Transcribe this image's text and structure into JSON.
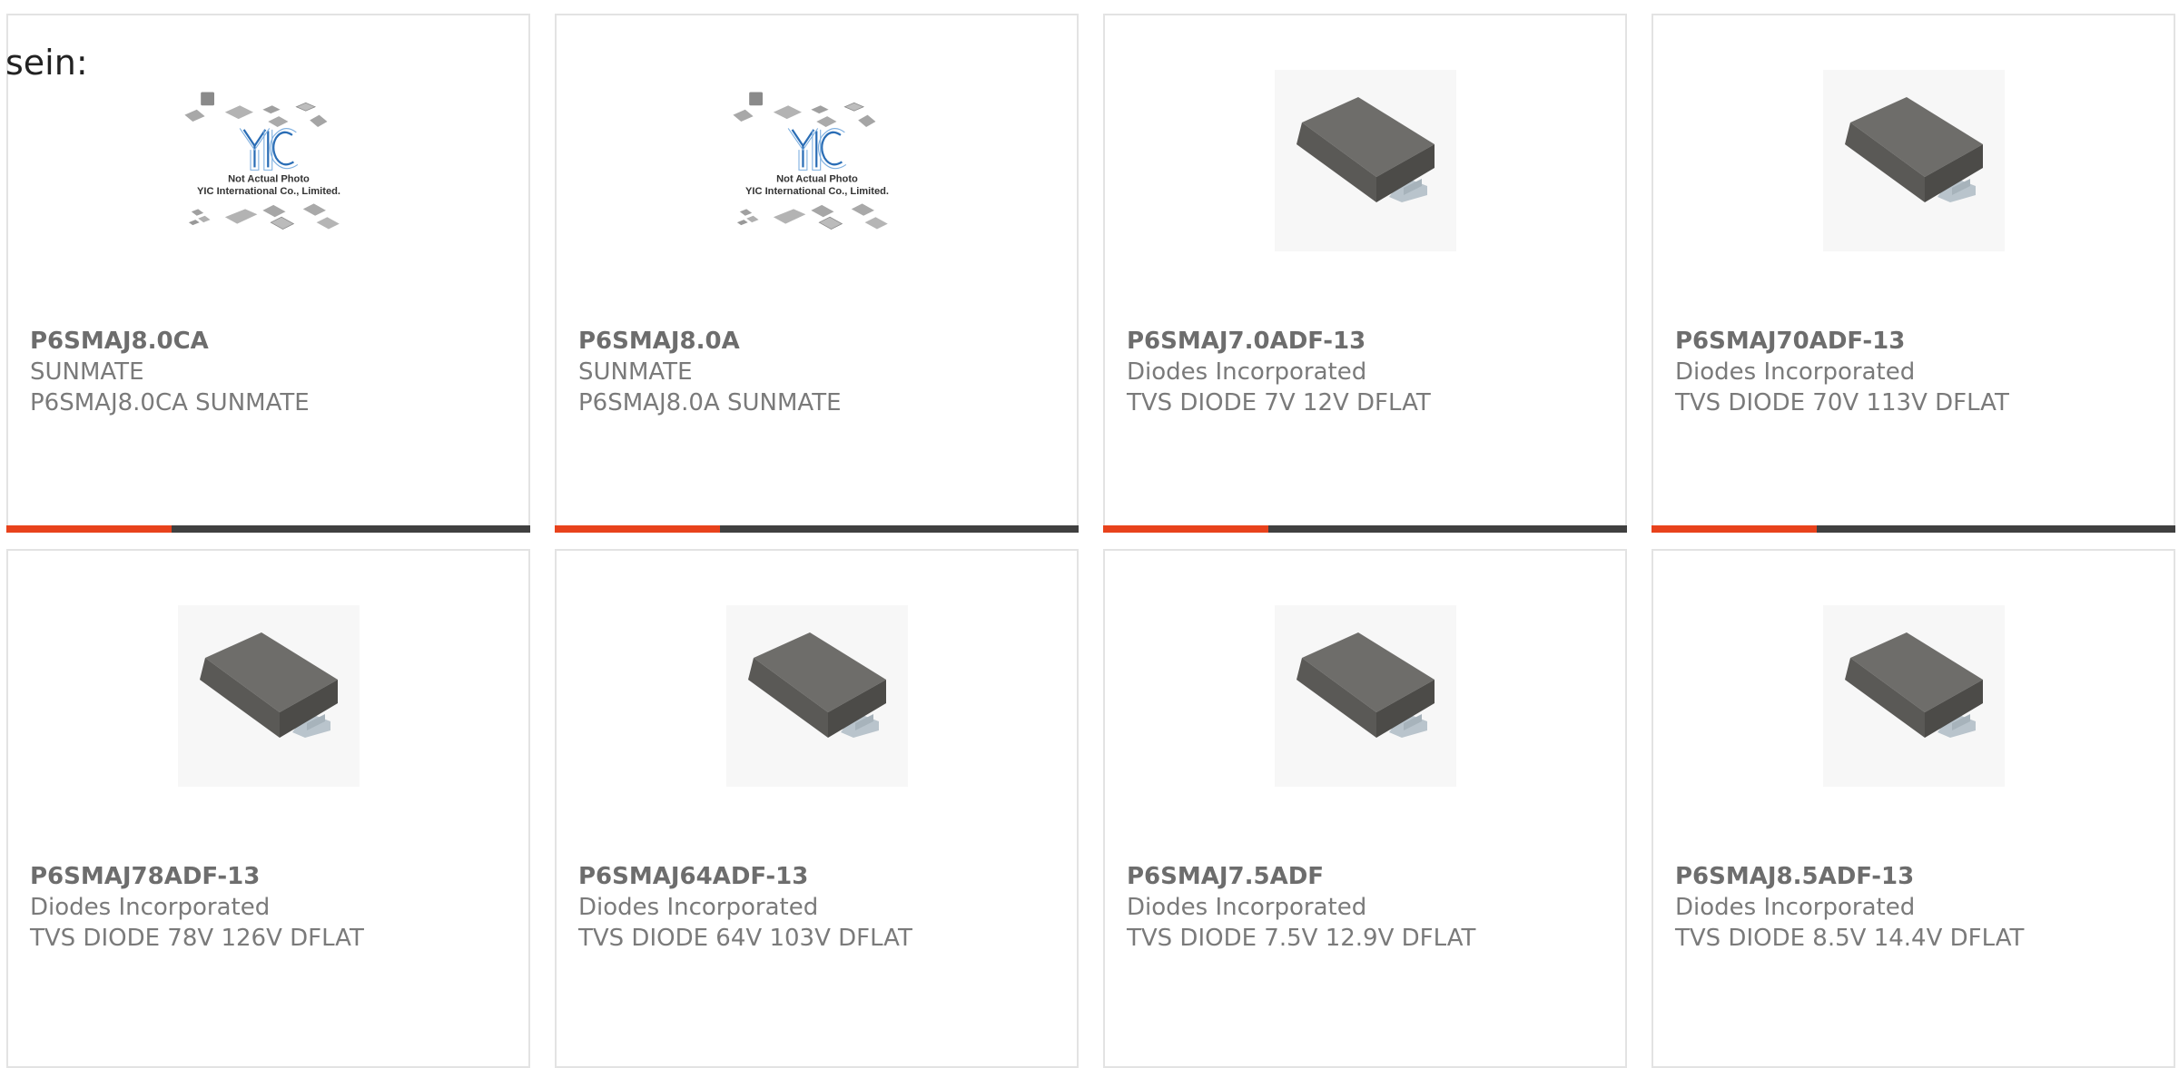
{
  "intro_text": "sein:",
  "placeholder_image": {
    "logo_text": "YIC",
    "caption_line1": "Not Actual Photo",
    "caption_line2": "YIC International Co., Limited."
  },
  "colors": {
    "accent": "#e8421c",
    "bar_dark": "#404040",
    "card_border": "#e3e3e3",
    "text": "#7a7a7a",
    "logo_blue": "#2a6db5"
  },
  "products": [
    {
      "part_number": "P6SMAJ8.0CA",
      "manufacturer": "SUNMATE",
      "description": "P6SMAJ8.0CA SUNMATE",
      "image": "yic-placeholder"
    },
    {
      "part_number": "P6SMAJ8.0A",
      "manufacturer": "SUNMATE",
      "description": "P6SMAJ8.0A SUNMATE",
      "image": "yic-placeholder"
    },
    {
      "part_number": "P6SMAJ7.0ADF-13",
      "manufacturer": "Diodes Incorporated",
      "description": "TVS DIODE 7V 12V DFLAT",
      "image": "smd-diode-package"
    },
    {
      "part_number": "P6SMAJ70ADF-13",
      "manufacturer": "Diodes Incorporated",
      "description": "TVS DIODE 70V 113V DFLAT",
      "image": "smd-diode-package"
    },
    {
      "part_number": "P6SMAJ78ADF-13",
      "manufacturer": "Diodes Incorporated",
      "description": "TVS DIODE 78V 126V DFLAT",
      "image": "smd-diode-package"
    },
    {
      "part_number": "P6SMAJ64ADF-13",
      "manufacturer": "Diodes Incorporated",
      "description": "TVS DIODE 64V 103V DFLAT",
      "image": "smd-diode-package"
    },
    {
      "part_number": "P6SMAJ7.5ADF",
      "manufacturer": "Diodes Incorporated",
      "description": "TVS DIODE 7.5V 12.9V DFLAT",
      "image": "smd-diode-package"
    },
    {
      "part_number": "P6SMAJ8.5ADF-13",
      "manufacturer": "Diodes Incorporated",
      "description": "TVS DIODE 8.5V 14.4V DFLAT",
      "image": "smd-diode-package"
    }
  ]
}
